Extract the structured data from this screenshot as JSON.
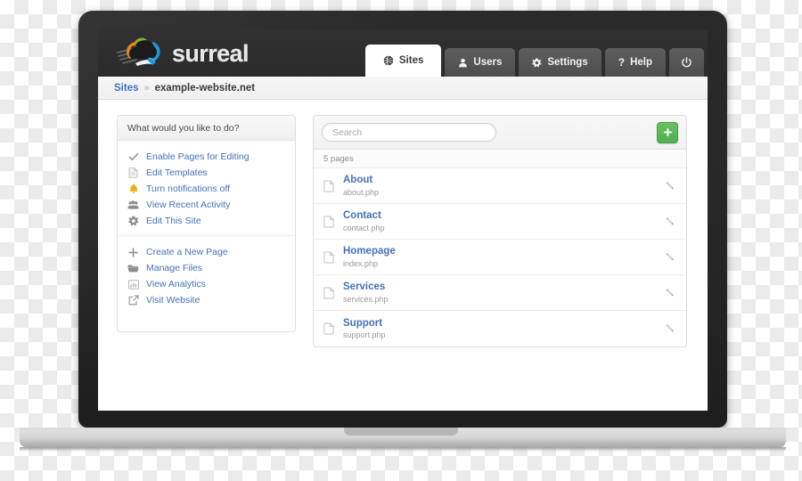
{
  "brand": {
    "name": "surreal",
    "logo_icon": "cloud-paintbrush-logo",
    "logo_colors": [
      "#7ab929",
      "#e8861e",
      "#1b9bd8"
    ]
  },
  "nav": {
    "tabs": [
      {
        "label": "Sites",
        "icon": "globe-icon",
        "active": true
      },
      {
        "label": "Users",
        "icon": "user-icon",
        "active": false
      },
      {
        "label": "Settings",
        "icon": "gear-icon",
        "active": false
      },
      {
        "label": "Help",
        "icon": "question-mark-icon",
        "active": false
      }
    ],
    "power": {
      "label": "",
      "icon": "power-icon"
    }
  },
  "breadcrumb": {
    "root": "Sites",
    "separator": "»",
    "current": "example-website.net"
  },
  "sidebar": {
    "header": "What would you like to do?",
    "groups": [
      {
        "items": [
          {
            "label": "Enable Pages for Editing",
            "icon": "check-icon",
            "icon_color": "#8d8d8d"
          },
          {
            "label": "Edit Templates",
            "icon": "document-icon",
            "icon_color": "#b5b5b5"
          },
          {
            "label": "Turn notifications off",
            "icon": "bell-icon",
            "icon_color": "#f0ad18"
          },
          {
            "label": "View Recent Activity",
            "icon": "group-icon",
            "icon_color": "#8d8d8d"
          },
          {
            "label": "Edit This Site",
            "icon": "gear-icon",
            "icon_color": "#8d8d8d"
          }
        ]
      },
      {
        "items": [
          {
            "label": "Create a New Page",
            "icon": "plus-icon",
            "icon_color": "#8d8d8d"
          },
          {
            "label": "Manage Files",
            "icon": "folder-icon",
            "icon_color": "#8d8d8d"
          },
          {
            "label": "View Analytics",
            "icon": "chart-image-icon",
            "icon_color": "#b5b5b5"
          },
          {
            "label": "Visit Website",
            "icon": "external-link-icon",
            "icon_color": "#8d8d8d"
          }
        ]
      }
    ]
  },
  "pages_panel": {
    "search": {
      "placeholder": "Search",
      "value": ""
    },
    "add_button": {
      "label": "+",
      "icon": "plus-icon",
      "color": "#5cb85c"
    },
    "count_label": "5 pages",
    "rows": [
      {
        "title": "About",
        "file": "about.php",
        "icon": "file-icon",
        "edit_icon": "pencil-icon"
      },
      {
        "title": "Contact",
        "file": "contact.php",
        "icon": "file-icon",
        "edit_icon": "pencil-icon"
      },
      {
        "title": "Homepage",
        "file": "index.php",
        "icon": "file-icon",
        "edit_icon": "pencil-icon"
      },
      {
        "title": "Services",
        "file": "services.php",
        "icon": "file-icon",
        "edit_icon": "pencil-icon"
      },
      {
        "title": "Support",
        "file": "support.php",
        "icon": "file-icon",
        "edit_icon": "pencil-icon"
      }
    ]
  },
  "device": {
    "type": "laptop-mockup"
  }
}
